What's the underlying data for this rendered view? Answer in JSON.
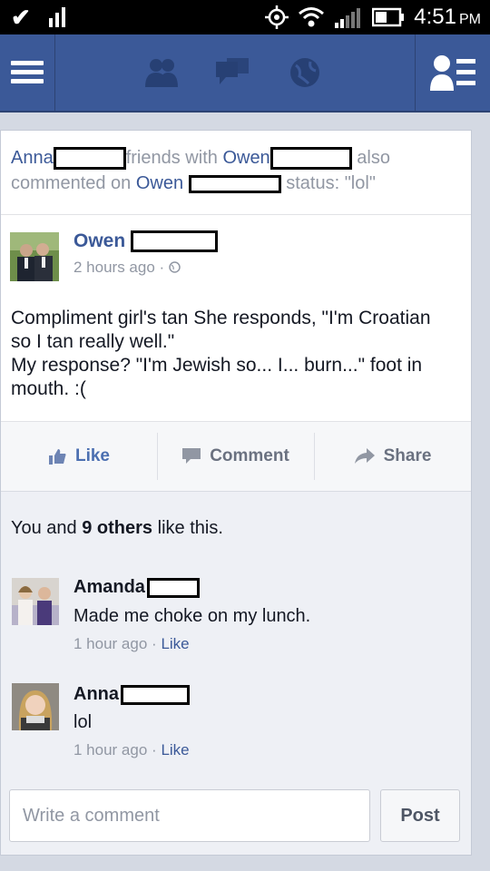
{
  "status_bar": {
    "time": "4:51",
    "ampm": "PM"
  },
  "story": {
    "actor": "Anna",
    "text1": "friends with",
    "friend": "Owen",
    "text2": "also commented on",
    "owner": "Owen",
    "text3": "status: \"lol\""
  },
  "post": {
    "author": "Owen",
    "time": "2 hours ago",
    "dot": "·",
    "lines": [
      "Compliment girl's tan She responds, \"I'm Croatian",
      "so I tan really well.\"",
      "My response? \"I'm Jewish so... I... burn...\" foot in",
      "mouth. :("
    ]
  },
  "actions": {
    "like": "Like",
    "comment": "Comment",
    "share": "Share"
  },
  "likes": {
    "prefix": "You and",
    "count": "9 others",
    "suffix": "like this."
  },
  "comments": [
    {
      "name": "Amanda",
      "text": "Made me choke on my lunch.",
      "time": "1 hour ago",
      "dot": "·",
      "like": "Like"
    },
    {
      "name": "Anna",
      "text": "lol",
      "time": "1 hour ago",
      "dot": "·",
      "like": "Like"
    }
  ],
  "composer": {
    "placeholder": "Write a comment",
    "post_label": "Post"
  },
  "colors": {
    "brand": "#3b5998",
    "link": "#3b5998",
    "muted": "#9197a3"
  }
}
